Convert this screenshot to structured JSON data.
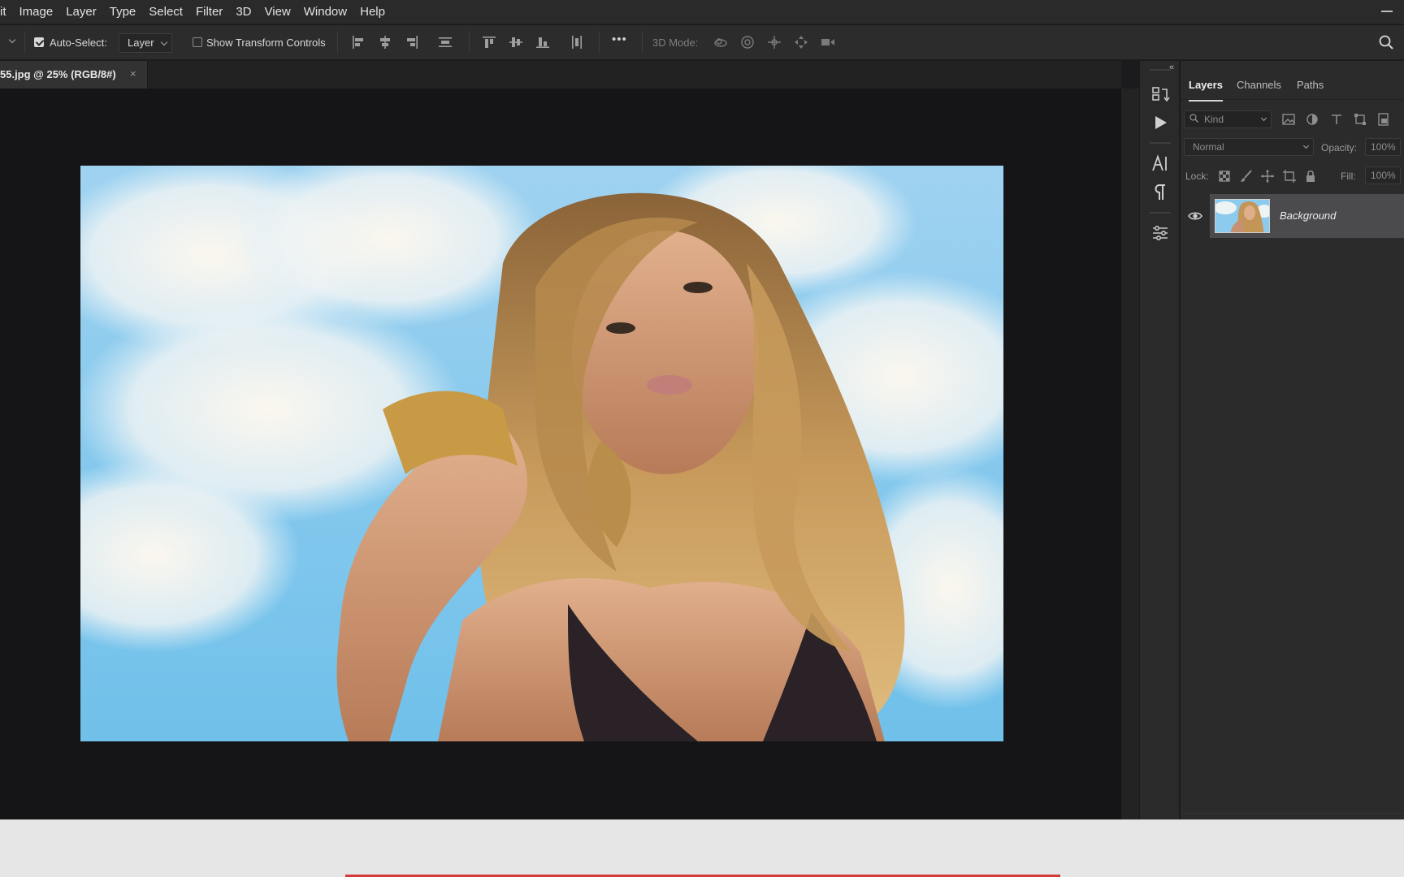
{
  "menubar": {
    "items": [
      "it",
      "Image",
      "Layer",
      "Type",
      "Select",
      "Filter",
      "3D",
      "View",
      "Window",
      "Help"
    ]
  },
  "optionsbar": {
    "auto_select_label": "Auto-Select:",
    "auto_select_checked": true,
    "auto_select_target": "Layer",
    "show_transform_label": "Show Transform Controls",
    "show_transform_checked": false,
    "mode_3d_label": "3D Mode:",
    "more_glyph": "•••"
  },
  "document": {
    "tab_title": "55.jpg @ 25% (RGB/8#)",
    "close_glyph": "×"
  },
  "layers_panel": {
    "tabs": [
      "Layers",
      "Channels",
      "Paths"
    ],
    "active_tab": "Layers",
    "filter_placeholder": "Kind",
    "blend_mode": "Normal",
    "opacity_label": "Opacity:",
    "opacity_value": "100%",
    "lock_label": "Lock:",
    "fill_label": "Fill:",
    "fill_value": "100%",
    "layers": [
      {
        "name": "Background",
        "visible": true
      }
    ]
  },
  "colors": {
    "accent_progress": "#d33a3a",
    "sky": "#7cc3ea"
  }
}
